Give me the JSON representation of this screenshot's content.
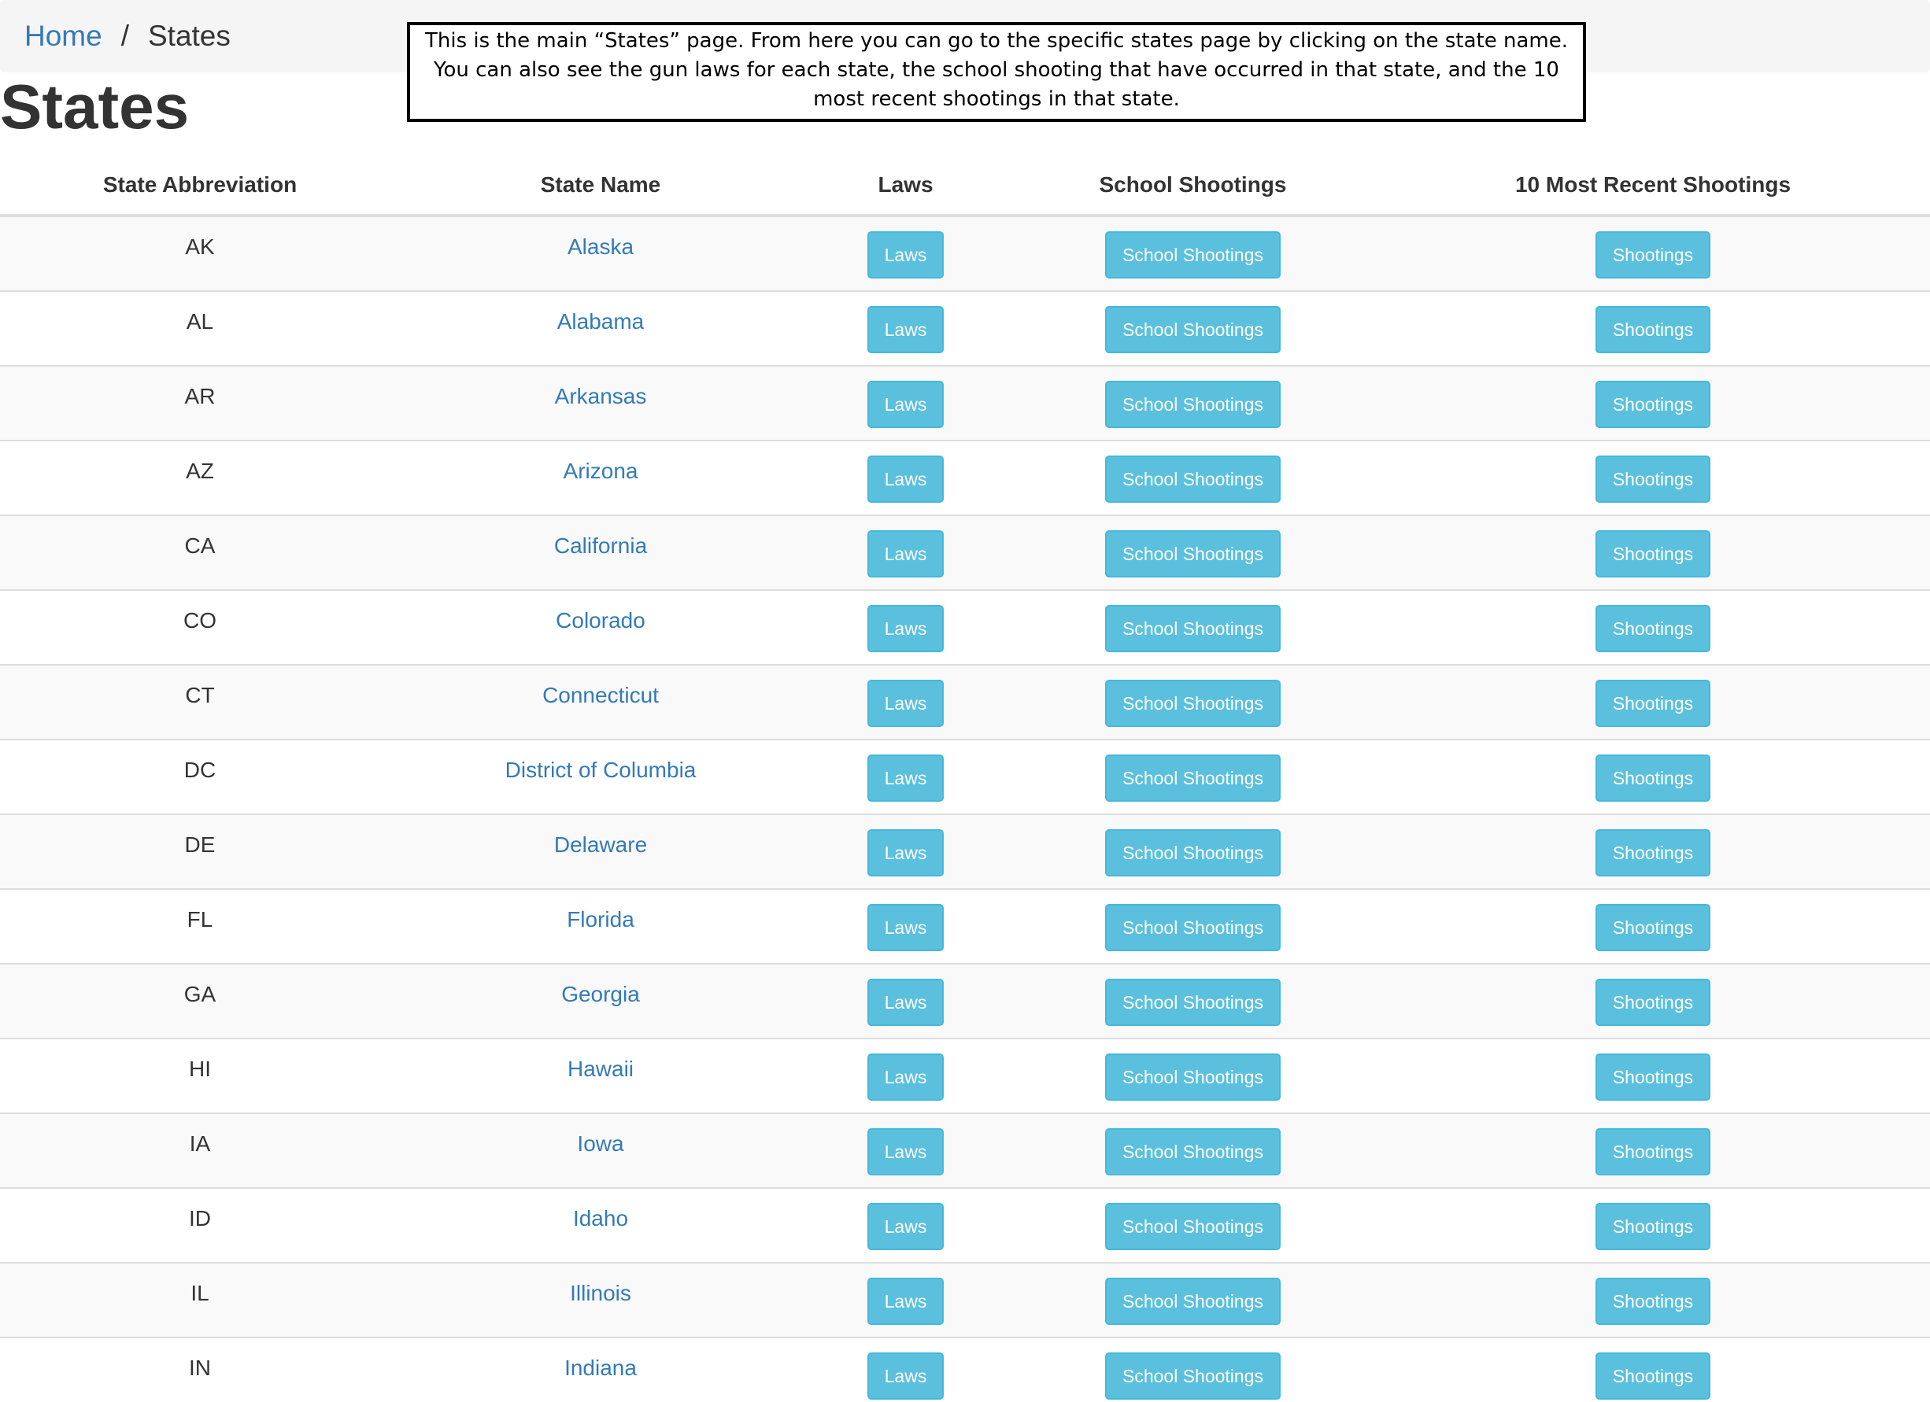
{
  "breadcrumb": {
    "home": "Home",
    "separator": "/",
    "current": "States"
  },
  "page_title": "States",
  "annotation": "This is the main “States” page. From here you can go to the specific states page by clicking on the state name. You can also see the gun laws for each state, the school shooting that have occurred in that state, and the 10 most recent shootings in that state.",
  "table": {
    "headers": {
      "abbr": "State Abbreviation",
      "name": "State Name",
      "laws": "Laws",
      "school": "School Shootings",
      "recent": "10 Most Recent Shootings"
    },
    "button_labels": {
      "laws": "Laws",
      "school": "School Shootings",
      "recent": "Shootings"
    },
    "rows": [
      {
        "abbr": "AK",
        "name": "Alaska"
      },
      {
        "abbr": "AL",
        "name": "Alabama"
      },
      {
        "abbr": "AR",
        "name": "Arkansas"
      },
      {
        "abbr": "AZ",
        "name": "Arizona"
      },
      {
        "abbr": "CA",
        "name": "California"
      },
      {
        "abbr": "CO",
        "name": "Colorado"
      },
      {
        "abbr": "CT",
        "name": "Connecticut"
      },
      {
        "abbr": "DC",
        "name": "District of Columbia"
      },
      {
        "abbr": "DE",
        "name": "Delaware"
      },
      {
        "abbr": "FL",
        "name": "Florida"
      },
      {
        "abbr": "GA",
        "name": "Georgia"
      },
      {
        "abbr": "HI",
        "name": "Hawaii"
      },
      {
        "abbr": "IA",
        "name": "Iowa"
      },
      {
        "abbr": "ID",
        "name": "Idaho"
      },
      {
        "abbr": "IL",
        "name": "Illinois"
      },
      {
        "abbr": "IN",
        "name": "Indiana"
      }
    ]
  },
  "colors": {
    "link": "#337ab7",
    "button_bg": "#5bc0de",
    "button_border": "#46b8da",
    "stripe": "#f9f9f9",
    "breadcrumb_bg": "#f5f5f5"
  }
}
